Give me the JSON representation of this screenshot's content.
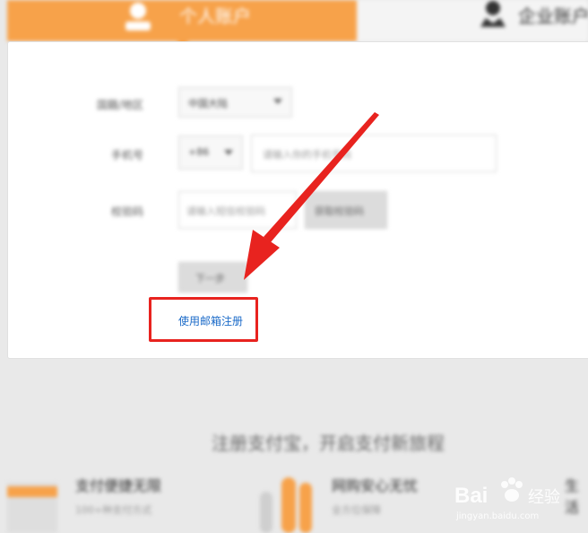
{
  "tabs": {
    "personal_label": "个人账户",
    "company_label": "企业账户"
  },
  "form": {
    "region_label": "国籍/地区",
    "region_value": "中国大陆",
    "phone_label": "手机号",
    "phone_code": "+86",
    "phone_placeholder": "请输入你的手机号码",
    "captcha_label": "校验码",
    "captcha_placeholder": "请输入短信校验码",
    "send_code_label": "获取校验码",
    "submit_label": "下一步"
  },
  "email_register_label": "使用邮箱注册",
  "promo": {
    "title": "注册支付宝，开启支付新旅程",
    "features": [
      {
        "title": "支付便捷无限",
        "sub": "100+种支付方式"
      },
      {
        "title": "网购安心无忧",
        "sub": "全方位保障"
      },
      {
        "title": "生活",
        "sub": ""
      }
    ]
  },
  "watermark": {
    "brand": "Bai",
    "brand2": "经验",
    "url": "jingyan.baidu.com"
  },
  "colors": {
    "accent": "#f7a24a",
    "highlight_red": "#e8231f",
    "link": "#1a6ac8"
  }
}
